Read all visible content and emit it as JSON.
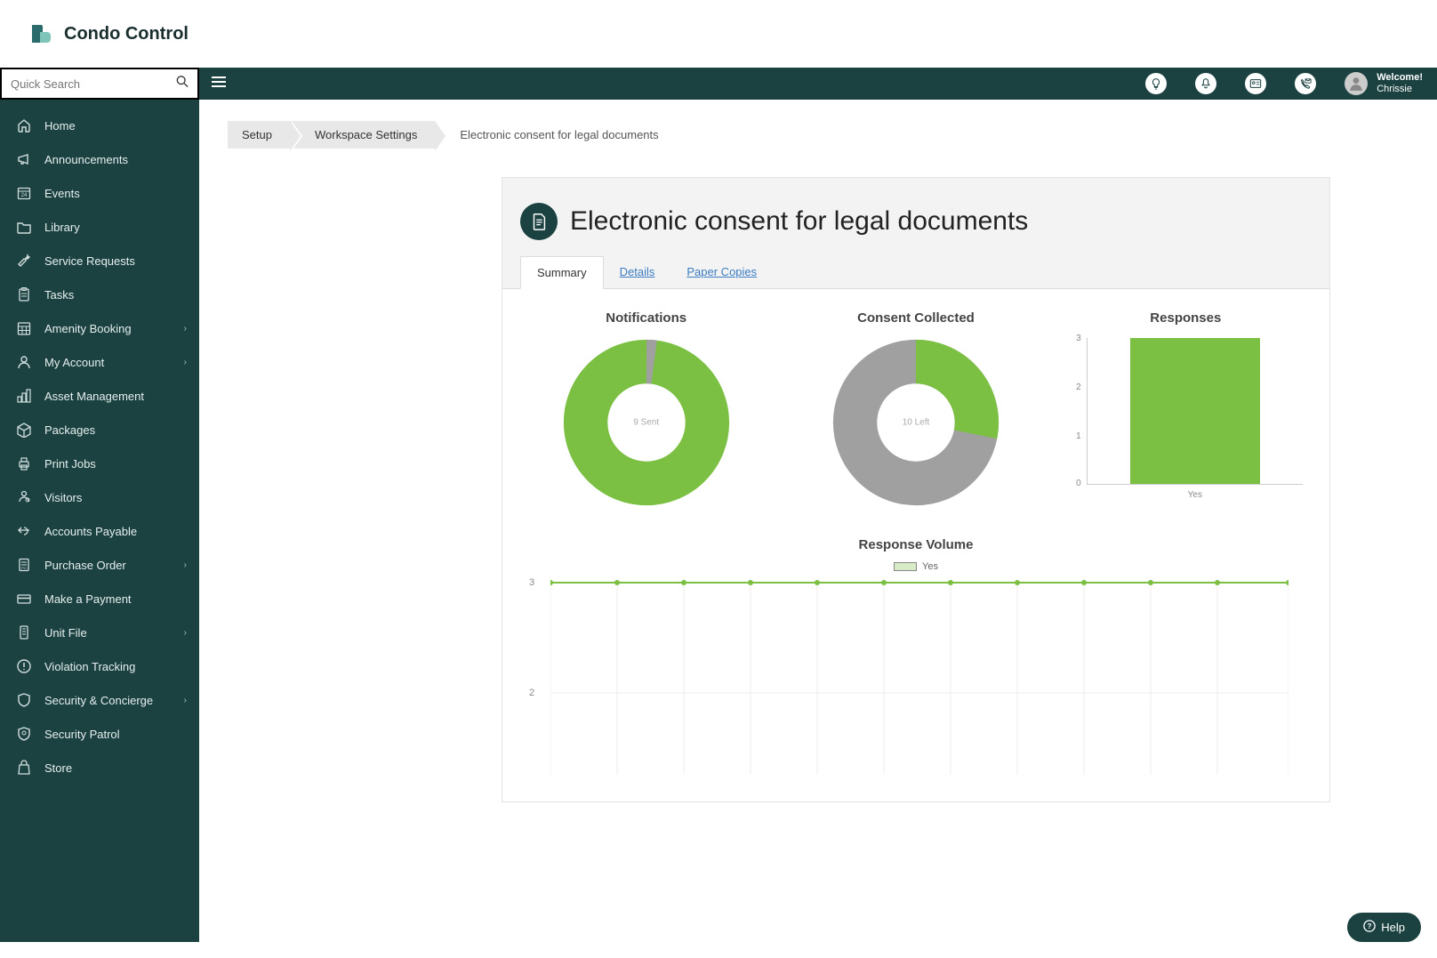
{
  "brand": {
    "name": "Condo Control"
  },
  "search": {
    "placeholder": "Quick Search"
  },
  "user": {
    "welcome": "Welcome!",
    "name": "Chrissie"
  },
  "sidebar": [
    {
      "label": "Home",
      "icon": "home",
      "chev": false
    },
    {
      "label": "Announcements",
      "icon": "megaphone",
      "chev": false
    },
    {
      "label": "Events",
      "icon": "calendar",
      "chev": false
    },
    {
      "label": "Library",
      "icon": "folder",
      "chev": false
    },
    {
      "label": "Service Requests",
      "icon": "wrench",
      "chev": false
    },
    {
      "label": "Tasks",
      "icon": "clipboard",
      "chev": false
    },
    {
      "label": "Amenity Booking",
      "icon": "calendar-grid",
      "chev": true
    },
    {
      "label": "My Account",
      "icon": "user",
      "chev": true
    },
    {
      "label": "Asset Management",
      "icon": "asset",
      "chev": false
    },
    {
      "label": "Packages",
      "icon": "package",
      "chev": false
    },
    {
      "label": "Print Jobs",
      "icon": "printer",
      "chev": false
    },
    {
      "label": "Visitors",
      "icon": "visitor",
      "chev": false
    },
    {
      "label": "Accounts Payable",
      "icon": "ap",
      "chev": false
    },
    {
      "label": "Purchase Order",
      "icon": "po",
      "chev": true
    },
    {
      "label": "Make a Payment",
      "icon": "card",
      "chev": false
    },
    {
      "label": "Unit File",
      "icon": "unit",
      "chev": true
    },
    {
      "label": "Violation Tracking",
      "icon": "violation",
      "chev": false
    },
    {
      "label": "Security & Concierge",
      "icon": "shield",
      "chev": true
    },
    {
      "label": "Security Patrol",
      "icon": "patrol",
      "chev": false
    },
    {
      "label": "Store",
      "icon": "store",
      "chev": false
    }
  ],
  "breadcrumb": [
    "Setup",
    "Workspace Settings",
    "Electronic consent for legal documents"
  ],
  "page": {
    "title": "Electronic consent for legal documents",
    "tabs": [
      "Summary",
      "Details",
      "Paper Copies"
    ],
    "activeTab": 0
  },
  "charts": {
    "notifications": {
      "title": "Notifications",
      "centerValue": "9",
      "centerLabel": "Sent"
    },
    "consent": {
      "title": "Consent Collected",
      "centerValue": "10",
      "centerLabel": "Left"
    },
    "responses": {
      "title": "Responses",
      "xlabel": "Yes"
    },
    "volume": {
      "title": "Response Volume",
      "legend": "Yes"
    }
  },
  "help": {
    "label": "Help"
  },
  "chart_data": [
    {
      "type": "pie",
      "title": "Notifications",
      "series": [
        {
          "name": "Sent",
          "value": 9,
          "color": "#7bc043"
        }
      ],
      "center_label": "9 Sent",
      "remaining_slice_fraction": 0.02
    },
    {
      "type": "pie",
      "title": "Consent Collected",
      "series": [
        {
          "name": "Collected",
          "value": 3,
          "color": "#7bc043"
        },
        {
          "name": "Left",
          "value": 10,
          "color": "#a0a0a0"
        }
      ],
      "center_label": "10 Left"
    },
    {
      "type": "bar",
      "title": "Responses",
      "categories": [
        "Yes"
      ],
      "values": [
        3
      ],
      "ylim": [
        0,
        3
      ],
      "yticks": [
        0,
        1,
        2,
        3
      ]
    },
    {
      "type": "line",
      "title": "Response Volume",
      "series": [
        {
          "name": "Yes",
          "values": [
            3,
            3,
            3,
            3,
            3,
            3,
            3,
            3,
            3,
            3,
            3,
            3
          ],
          "color": "#7bc043"
        }
      ],
      "yticks": [
        2,
        3
      ],
      "ylim": [
        1.5,
        3.2
      ],
      "x_count": 12
    }
  ]
}
